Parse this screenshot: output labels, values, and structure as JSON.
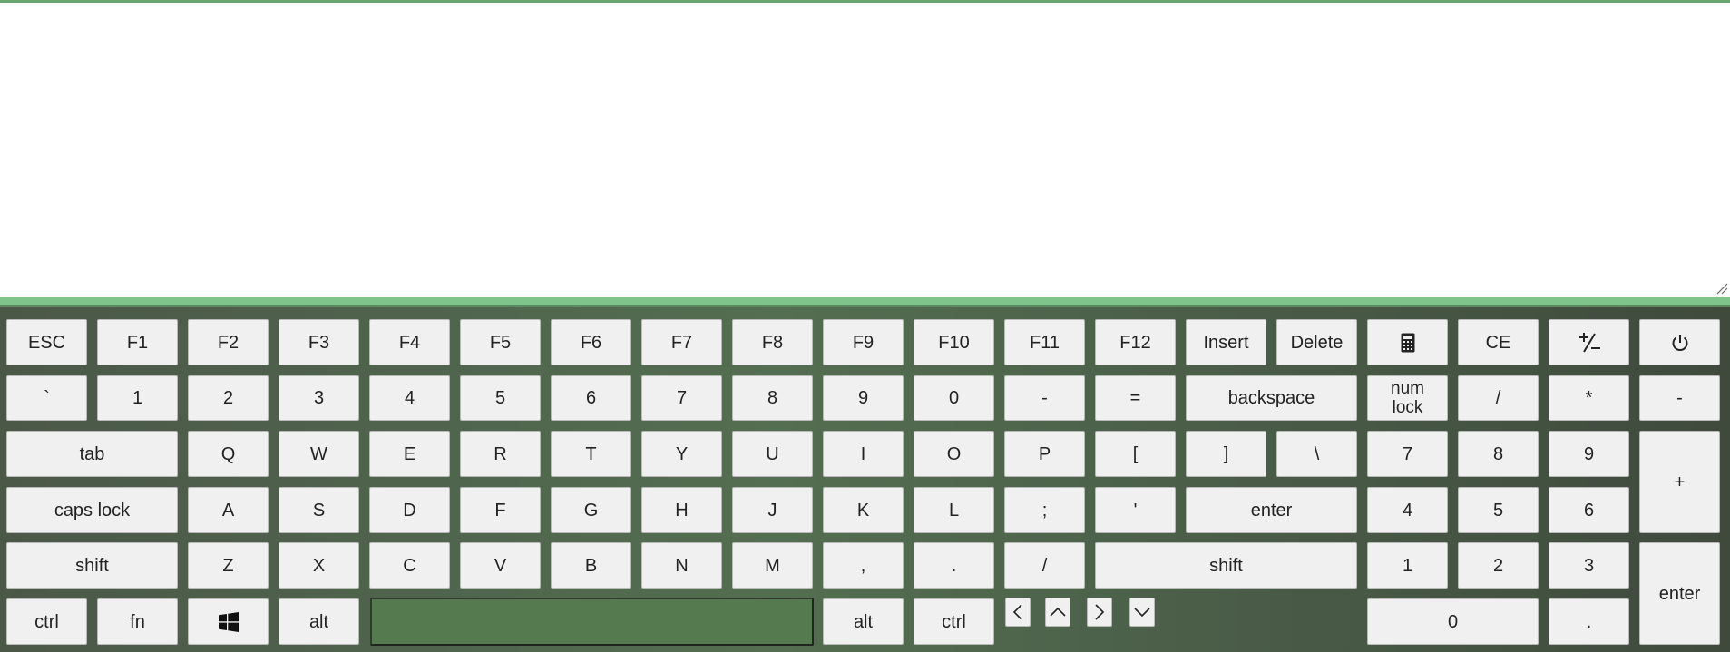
{
  "text_area": {
    "value": ""
  },
  "keyboard": {
    "row1": [
      "ESC",
      "F1",
      "F2",
      "F3",
      "F4",
      "F5",
      "F6",
      "F7",
      "F8",
      "F9",
      "F10",
      "F11",
      "F12",
      "Insert",
      "Delete"
    ],
    "row1_right": {
      "ce": "CE",
      "calc_icon": "calculator-icon",
      "plusminus_icon": "plus-minus-icon",
      "power_icon": "power-icon"
    },
    "row2": [
      "`",
      "1",
      "2",
      "3",
      "4",
      "5",
      "6",
      "7",
      "8",
      "9",
      "0",
      "-",
      "="
    ],
    "backspace": "backspace",
    "num_lock": "num\nlock",
    "row2_num": [
      "/",
      "*",
      "-"
    ],
    "tab": "tab",
    "row3": [
      "Q",
      "W",
      "E",
      "R",
      "T",
      "Y",
      "U",
      "I",
      "O",
      "P",
      "[",
      "]",
      "\\"
    ],
    "row3_num": [
      "7",
      "8",
      "9"
    ],
    "num_plus": "+",
    "caps_lock": "caps lock",
    "row4": [
      "A",
      "S",
      "D",
      "F",
      "G",
      "H",
      "J",
      "K",
      "L",
      ";",
      "'"
    ],
    "enter": "enter",
    "row4_num": [
      "4",
      "5",
      "6"
    ],
    "shift_left": "shift",
    "row5": [
      "Z",
      "X",
      "C",
      "V",
      "B",
      "N",
      "M",
      ",",
      ".",
      "/"
    ],
    "shift_right": "shift",
    "row5_num": [
      "1",
      "2",
      "3"
    ],
    "num_enter": "enter",
    "bottom": {
      "ctrl_left": "ctrl",
      "fn": "fn",
      "windows_icon": "windows-icon",
      "alt_left": "alt",
      "space": "",
      "alt_right": "alt",
      "ctrl_right": "ctrl"
    },
    "arrows": [
      "arrow-left-icon",
      "arrow-up-icon",
      "arrow-right-icon",
      "arrow-down-icon"
    ],
    "num_zero": "0",
    "num_dot": "."
  }
}
